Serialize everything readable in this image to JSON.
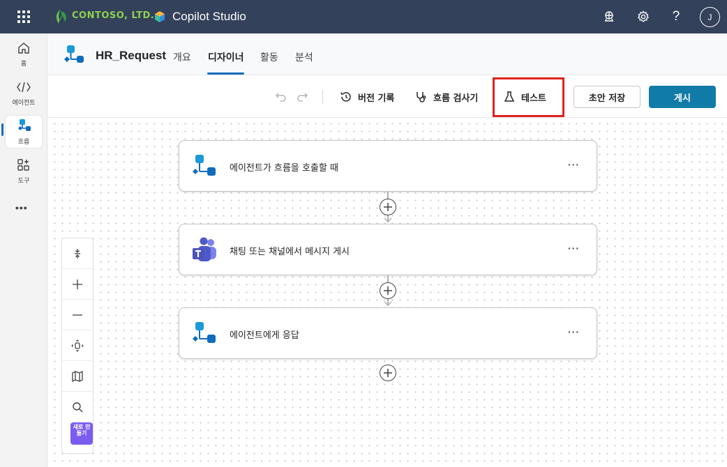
{
  "topbar": {
    "org_name": "CONTOSO, LTD.",
    "product_name": "Copilot Studio",
    "avatar_initial": "J",
    "icons": [
      "waffle-icon",
      "copilot-help-icon",
      "gear-icon",
      "question-icon"
    ]
  },
  "rail": {
    "items": [
      {
        "label": "홈",
        "icon": "home-icon"
      },
      {
        "label": "에이전트",
        "icon": "agents-icon"
      },
      {
        "label": "흐름",
        "icon": "flow-icon"
      },
      {
        "label": "도구",
        "icon": "tools-icon"
      }
    ],
    "more": "•••"
  },
  "header": {
    "flow_name": "HR_Request",
    "tabs": [
      {
        "label": "개요"
      },
      {
        "label": "디자이너"
      },
      {
        "label": "활동"
      },
      {
        "label": "분석"
      }
    ]
  },
  "toolbar": {
    "version_history": "버전 기록",
    "flow_checker": "흐름 검사기",
    "test": "테스트",
    "save_draft": "초안 저장",
    "publish": "게시"
  },
  "canvas": {
    "nodes": [
      {
        "label": "에이전트가 흐름을 호출할 때",
        "icon": "flow-trigger-icon",
        "more": "···"
      },
      {
        "label": "채팅 또는 채널에서 메시지 게시",
        "icon": "teams-icon",
        "more": "···"
      },
      {
        "label": "에이전트에게 응답",
        "icon": "flow-response-icon",
        "more": "···"
      }
    ],
    "zoom_panel": {
      "new_badge": "새로 만들기"
    }
  },
  "colors": {
    "topbar_bg": "#33415a",
    "accent": "#0f6cbd",
    "publish_bg": "#117ba8",
    "highlight": "#e0231f"
  }
}
